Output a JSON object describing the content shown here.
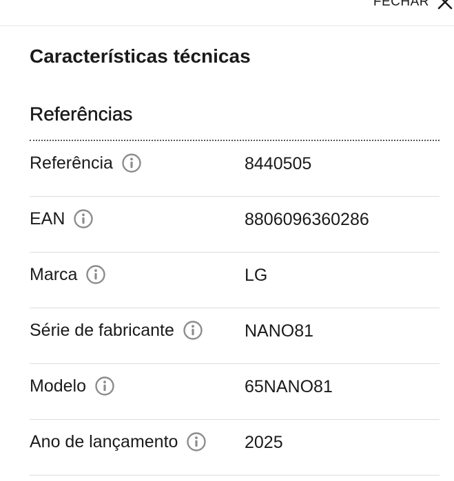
{
  "header": {
    "close_label": "FECHAR",
    "close_icon": "close-icon"
  },
  "page_title": "Características técnicas",
  "section": {
    "title": "Referências",
    "rows": [
      {
        "label": "Referência",
        "value": "8440505",
        "icon": "info-icon"
      },
      {
        "label": "EAN",
        "value": "8806096360286",
        "icon": "info-icon"
      },
      {
        "label": "Marca",
        "value": "LG",
        "icon": "info-icon"
      },
      {
        "label": "Série de fabricante",
        "value": "NANO81",
        "icon": "info-icon"
      },
      {
        "label": "Modelo",
        "value": "65NANO81",
        "icon": "info-icon"
      },
      {
        "label": "Ano de lançamento",
        "value": "2025",
        "icon": "info-icon"
      }
    ]
  },
  "colors": {
    "text": "#1a1a1a",
    "icon": "#8c8c8c",
    "divider": "#dcdcdc",
    "section_rule": "#555555"
  }
}
